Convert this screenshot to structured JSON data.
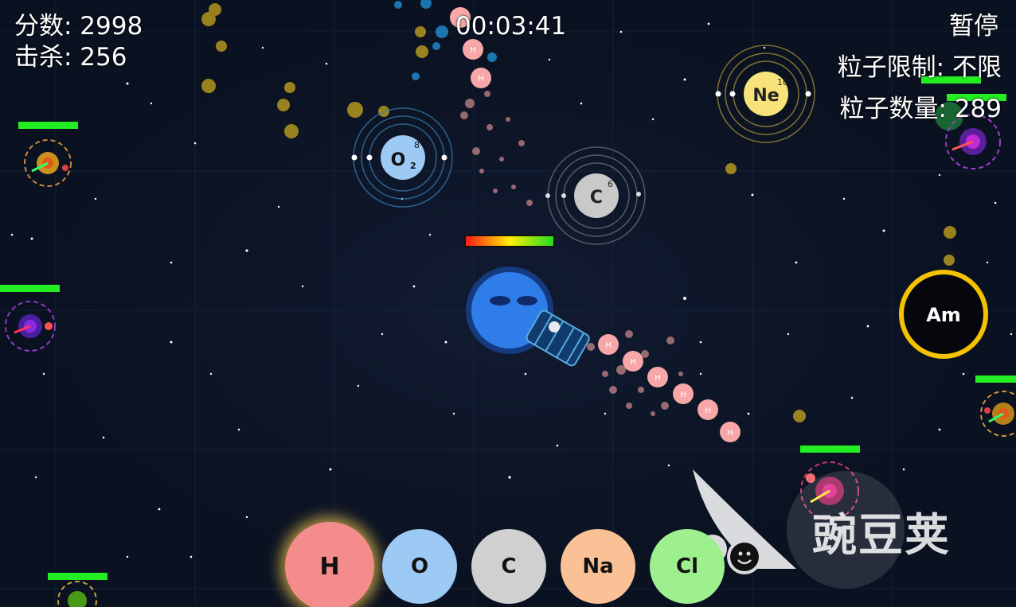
{
  "hud": {
    "score_label": "分数: 2998",
    "kills_label": "击杀: 256",
    "timer": "00:03:41",
    "pause_label": "暂停",
    "particle_limit_label": "粒子限制:  不限",
    "particle_count_label": "粒子数量:  289"
  },
  "atoms": {
    "oxygen": {
      "symbol": "O",
      "subscript": "2",
      "number": "8",
      "color": "#9ccaf5"
    },
    "carbon": {
      "symbol": "C",
      "number": "6",
      "color": "#c9c9c9"
    },
    "neon": {
      "symbol": "Ne",
      "number": "10",
      "color": "#f7e37a"
    },
    "americium": {
      "symbol": "Am",
      "ring_color": "#f5c200"
    }
  },
  "player": {
    "health_fraction": 1.0,
    "body_color": "#2f7de8",
    "projectile_label": "H"
  },
  "element_buttons": [
    {
      "symbol": "H",
      "color": "#f58c8c",
      "selected": true
    },
    {
      "symbol": "O",
      "color": "#9ccaf5",
      "selected": false
    },
    {
      "symbol": "C",
      "color": "#d0d0d0",
      "selected": false
    },
    {
      "symbol": "Na",
      "color": "#f9c195",
      "selected": false
    },
    {
      "symbol": "Cl",
      "color": "#9ef08f",
      "selected": false
    }
  ],
  "watermark": {
    "text": "豌豆荚"
  },
  "colors": {
    "enemy_health": "#22ee22",
    "projectile": "#f7a7a7",
    "background": "#0a1120"
  }
}
